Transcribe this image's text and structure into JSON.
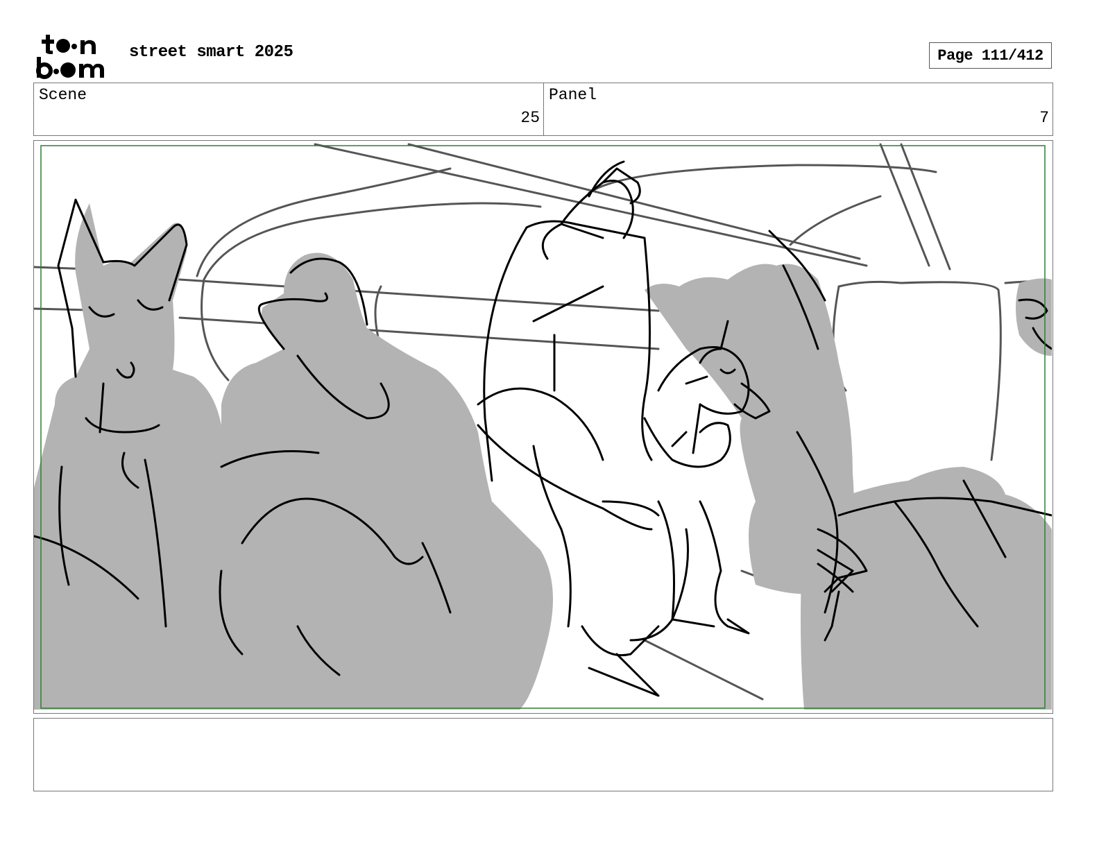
{
  "header": {
    "logo_line1": "toon",
    "logo_line2": "boom",
    "project_title": "street smart 2025",
    "page_label": "Page 111/412"
  },
  "info": {
    "scene_label": "Scene",
    "scene_value": "25",
    "panel_label": "Panel",
    "panel_value": "7"
  },
  "panel_image": {
    "safe_frame_color": "#2e7d32",
    "fill_color": "#b3b3b3",
    "line_color": "#000000"
  },
  "notes": {
    "text": ""
  }
}
